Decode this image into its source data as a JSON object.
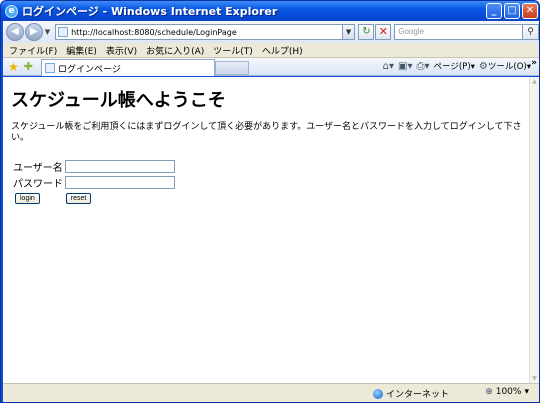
{
  "window": {
    "title": "ログインページ - Windows Internet Explorer"
  },
  "address_bar": {
    "url": "http://localhost:8080/schedule/LoginPage",
    "search_placeholder": "Google"
  },
  "menu": [
    "ファイル(F)",
    "編集(E)",
    "表示(V)",
    "お気に入り(A)",
    "ツール(T)",
    "ヘルプ(H)"
  ],
  "tab": {
    "label": "ログインページ"
  },
  "command_bar": {
    "page_label": "ページ(P)",
    "tools_label": "ツール(O)"
  },
  "page": {
    "heading": "スケジュール帳へようこそ",
    "intro": "スケジュール帳をご利用頂くにはまずログインして頂く必要があります。ユーザー名とパスワードを入力してログインして下さい。",
    "username_label": "ユーザー名",
    "password_label": "パスワード",
    "username_value": "",
    "password_value": "",
    "login_button": "login",
    "reset_button": "reset"
  },
  "status_bar": {
    "zone": "インターネット",
    "zoom": "100%"
  },
  "icons": {
    "back": "back-arrow-icon",
    "forward": "forward-arrow-icon",
    "refresh": "refresh-icon",
    "stop": "stop-icon",
    "search": "search-icon",
    "favorites": "favorites-star-icon",
    "add_favorite": "add-favorite-icon",
    "home": "home-icon",
    "feeds": "feeds-icon",
    "print": "print-icon",
    "page": "page-icon",
    "tools": "tools-gear-icon",
    "globe": "internet-globe-icon",
    "zoom": "zoom-icon"
  }
}
